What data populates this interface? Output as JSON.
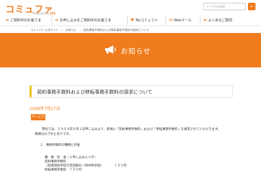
{
  "header": {
    "logo": "コミュファ",
    "logo_sub_prefix": "Powered by",
    "logo_sub_brand": "ctc",
    "search_placeholder": "サイト内を検索",
    "search_icon": "search-icon"
  },
  "nav": {
    "items": [
      {
        "label": "ご契約中のお客さま",
        "icon": "arrow-right-icon"
      },
      {
        "label": "お申し込みをご契約中のお客さま",
        "icon": "arrow-right-icon"
      },
      {
        "label": "Myコミュファ",
        "icon": "heart-icon"
      },
      {
        "label": "Webメール",
        "icon": "mail-icon"
      },
      {
        "label": "よくあるご質問",
        "icon": "arrow-right-icon"
      }
    ]
  },
  "breadcrumb": [
    "コミュファ 公式サイト",
    "お知らせ",
    "契約事務手数料および移転事務手数料の請求について"
  ],
  "banner": {
    "title": "お知らせ",
    "icon": "megaphone-icon",
    "color": "#f07c1d"
  },
  "article": {
    "title": "契約事務手数料および移転事務手数料の請求について",
    "date": "2009年7月27日",
    "category": "サービス",
    "lines": [
      "弊社では、２００９年８月１日申し込みより、新規に「契約事務手数料」および「移転事務手数料」を請求させていただきます。",
      "概要は以下のとおりです。",
      "１．事務手数料の種類と料金",
      "種　類　料　金（１申し込みにつき）",
      "契約事務手数料",
      "（新規契約手続き及回線の一時中断手続）　　　　７３５円",
      "移転事務手数料　７３５円"
    ]
  }
}
